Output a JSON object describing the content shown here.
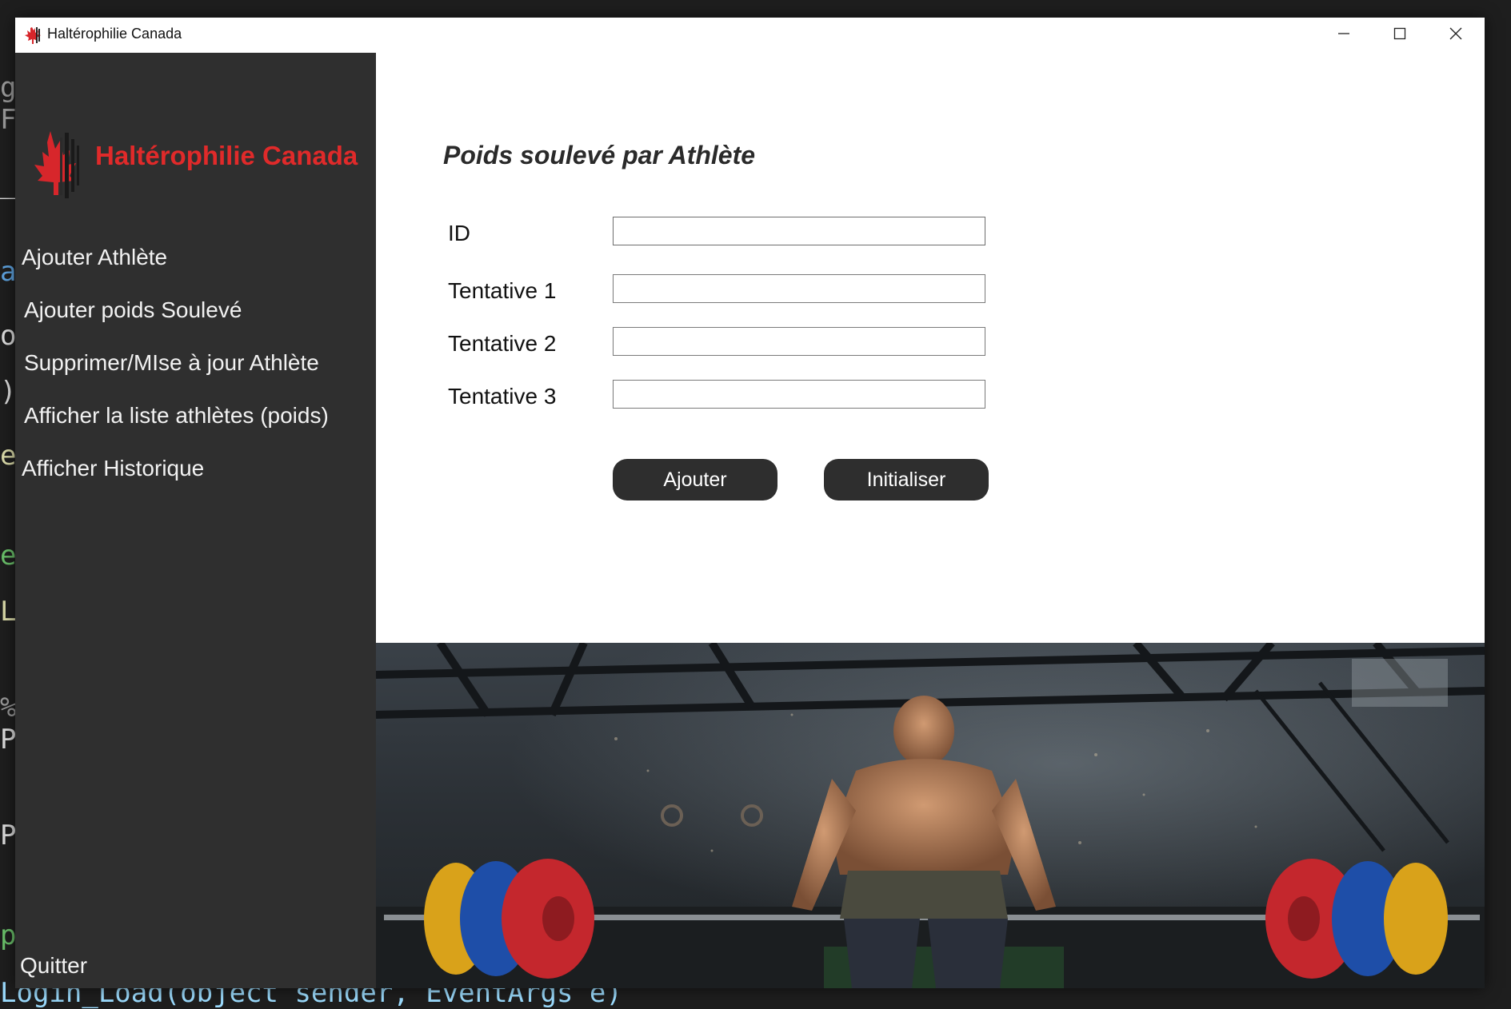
{
  "window": {
    "title": "Haltérophilie Canada"
  },
  "sidebar": {
    "brand": "Haltérophilie Canada",
    "items": [
      {
        "label": "Ajouter Athlète"
      },
      {
        "label": "Ajouter poids Soulevé"
      },
      {
        "label": "Supprimer/MIse à jour Athlète"
      },
      {
        "label": "Afficher la liste athlètes (poids)"
      },
      {
        "label": "Afficher Historique"
      }
    ],
    "quit_label": "Quitter"
  },
  "form": {
    "heading": "Poids soulevé par Athlète",
    "fields": [
      {
        "label": "ID",
        "value": ""
      },
      {
        "label": "Tentative 1",
        "value": ""
      },
      {
        "label": "Tentative 2",
        "value": ""
      },
      {
        "label": "Tentative 3",
        "value": ""
      }
    ],
    "add_button": "Ajouter",
    "reset_button": "Initialiser"
  },
  "background_code": {
    "bottom_line": "Login_Load(object sender, EventArgs e)",
    "fragments": [
      "g.",
      "Fo",
      "_N",
      "as",
      "ou",
      ")",
      "eC",
      "e",
      "Lb",
      "%",
      "Pa",
      "Pa",
      "pa"
    ]
  },
  "colors": {
    "sidebar_bg": "#2f2f2f",
    "brand_red": "#e02a2a",
    "button_bg": "#2e2e2e",
    "window_bg": "#ffffff"
  },
  "icons": {
    "app": "maple-leaf-barbell-icon",
    "minimize": "minimize-icon",
    "maximize": "maximize-icon",
    "close": "close-icon"
  }
}
